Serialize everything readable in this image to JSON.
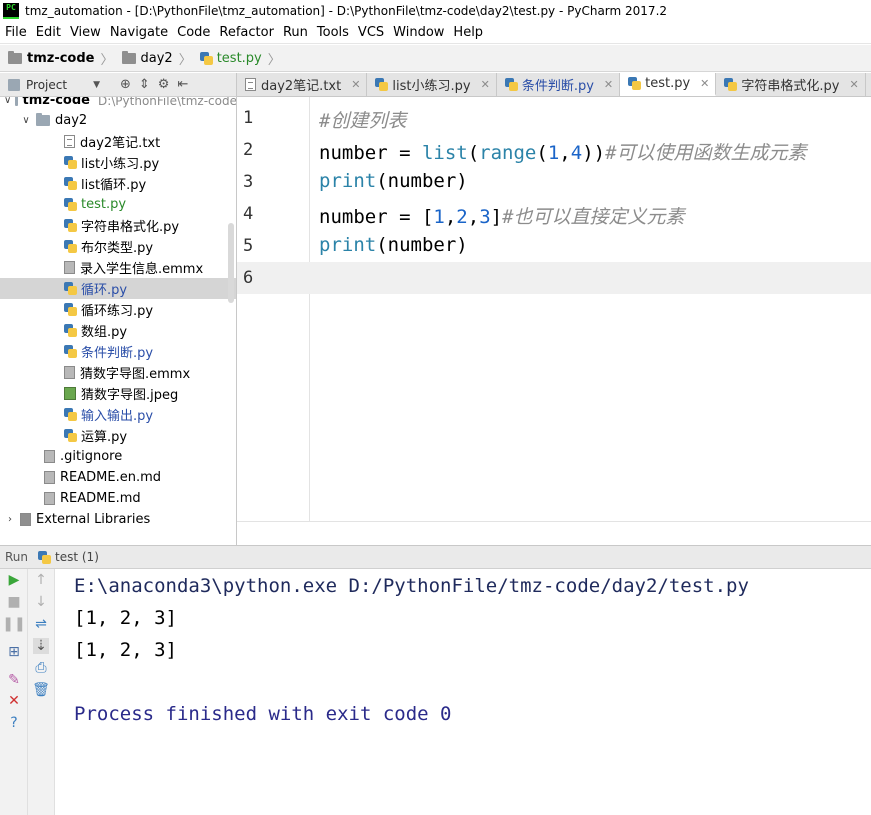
{
  "window": {
    "title": "tmz_automation - [D:\\PythonFile\\tmz_automation] - D:\\PythonFile\\tmz-code\\day2\\test.py - PyCharm 2017.2",
    "app_icon_text": "PC"
  },
  "menu": [
    "File",
    "Edit",
    "View",
    "Navigate",
    "Code",
    "Refactor",
    "Run",
    "Tools",
    "VCS",
    "Window",
    "Help"
  ],
  "breadcrumb": [
    "tmz-code",
    "day2",
    "test.py"
  ],
  "project_panel": {
    "label": "Project",
    "tree": [
      {
        "label": "tmz-code",
        "extra": "D:\\PythonFile\\tmz-code",
        "icon": "folder-icon"
      },
      {
        "label": "day2",
        "icon": "folder-icon"
      },
      {
        "label": "day2笔记.txt",
        "icon": "text-file-icon"
      },
      {
        "label": "list小练习.py",
        "icon": "python-file-icon"
      },
      {
        "label": "list循环.py",
        "icon": "python-file-icon"
      },
      {
        "label": "test.py",
        "icon": "python-file-icon"
      },
      {
        "label": "字符串格式化.py",
        "icon": "python-file-icon"
      },
      {
        "label": "布尔类型.py",
        "icon": "python-file-icon"
      },
      {
        "label": "录入学生信息.emmx",
        "icon": "file-icon"
      },
      {
        "label": "循环.py",
        "icon": "python-file-icon"
      },
      {
        "label": "循环练习.py",
        "icon": "python-file-icon"
      },
      {
        "label": "数组.py",
        "icon": "python-file-icon"
      },
      {
        "label": "条件判断.py",
        "icon": "python-file-icon"
      },
      {
        "label": "猜数字导图.emmx",
        "icon": "file-icon"
      },
      {
        "label": "猜数字导图.jpeg",
        "icon": "image-file-icon"
      },
      {
        "label": "输入输出.py",
        "icon": "python-file-icon"
      },
      {
        "label": "运算.py",
        "icon": "python-file-icon"
      },
      {
        "label": ".gitignore",
        "icon": "file-icon"
      },
      {
        "label": "README.en.md",
        "icon": "file-icon"
      },
      {
        "label": "README.md",
        "icon": "file-icon"
      },
      {
        "label": "External Libraries",
        "icon": "library-icon"
      }
    ]
  },
  "tabs": [
    {
      "label": "day2笔记.txt",
      "active": false
    },
    {
      "label": "list小练习.py",
      "active": false
    },
    {
      "label": "条件判断.py",
      "active": false
    },
    {
      "label": "test.py",
      "active": true
    },
    {
      "label": "字符串格式化.py",
      "active": false
    }
  ],
  "editor": {
    "line_numbers": [
      "1",
      "2",
      "3",
      "4",
      "5",
      "6"
    ],
    "lines": [
      {
        "comment": "#创建列表"
      },
      {
        "a": "number = ",
        "b": "list",
        "c": "(",
        "d": "range",
        "e": "(",
        "f": "1",
        "g": ",",
        "h": "4",
        "i": "))",
        "comment": "#可以使用函数生成元素"
      },
      {
        "b": "print",
        "c": "(number)"
      },
      {
        "a": "number = [",
        "f": "1",
        "g": ",",
        "h": "2",
        "i": ",",
        "j": "3",
        "k": "]",
        "comment": "#也可以直接定义元素"
      },
      {
        "b": "print",
        "c": "(number)"
      }
    ]
  },
  "run_panel": {
    "label": "Run",
    "tab": "test (1)",
    "console": [
      "E:\\anaconda3\\python.exe D:/PythonFile/tmz-code/day2/test.py",
      "[1, 2, 3]",
      "[1, 2, 3]",
      "",
      "Process finished with exit code 0"
    ]
  },
  "colors": {
    "comment": "#8c8c8c",
    "builtin": "#2b83a8",
    "number": "#1a64c8",
    "run_green": "#3aa63a"
  }
}
